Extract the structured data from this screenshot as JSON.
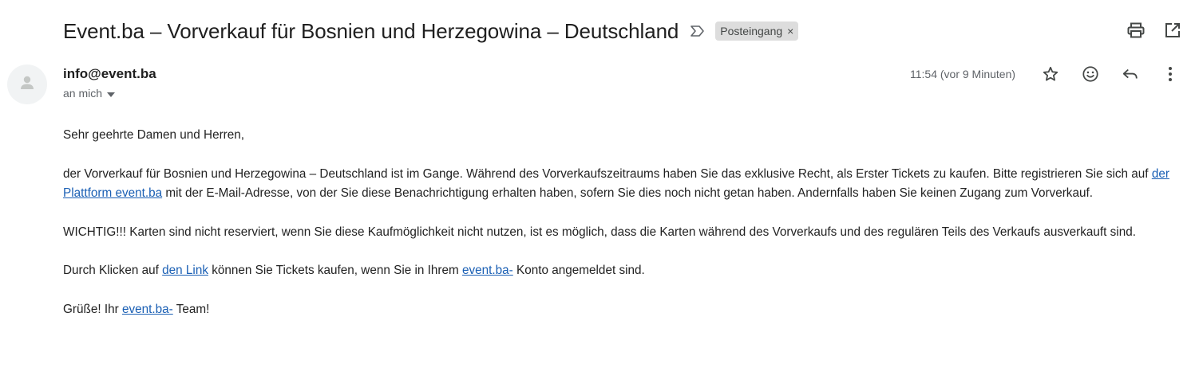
{
  "email": {
    "subject": "Event.ba – Vorverkauf für Bosnien und Herzegowina – Deutschland",
    "label": "Posteingang",
    "label_remove": "×",
    "sender": "info@event.ba",
    "to": "an mich",
    "time": "11:54 (vor 9 Minuten)"
  },
  "body": {
    "greeting": "Sehr geehrte Damen und Herren,",
    "p2_a": "der Vorverkauf für Bosnien und Herzegowina – Deutschland ist im Gange. Während des Vorverkaufszeitraums haben Sie das exklusive Recht, als Erster Tickets zu kaufen. Bitte registrieren Sie sich auf ",
    "p2_link": "der Plattform event.ba",
    "p2_b": " mit der E-Mail-Adresse, von der Sie diese Benachrichtigung erhalten haben, sofern Sie dies noch nicht getan haben. Andernfalls haben Sie keinen Zugang zum Vorverkauf.",
    "p3": "WICHTIG!!! Karten sind nicht reserviert, wenn Sie diese Kaufmöglichkeit nicht nutzen, ist es möglich, dass die Karten während des Vorverkaufs und des regulären Teils des Verkaufs ausverkauft sind.",
    "p4_a": "Durch Klicken auf ",
    "p4_link1": "den Link",
    "p4_b": " können Sie Tickets kaufen, wenn Sie in Ihrem ",
    "p4_link2": "event.ba-",
    "p4_c": " Konto angemeldet sind.",
    "p5_a": "Grüße! Ihr ",
    "p5_link": "event.ba-",
    "p5_b": " Team!"
  },
  "icons": {
    "importance": "importance-marker-icon",
    "print": "print-icon",
    "open_new": "open-in-new-window-icon",
    "avatar": "person-icon",
    "caret": "caret-down-icon",
    "star": "star-icon",
    "emoji": "emoji-icon",
    "reply": "reply-icon",
    "more": "more-vert-icon"
  }
}
